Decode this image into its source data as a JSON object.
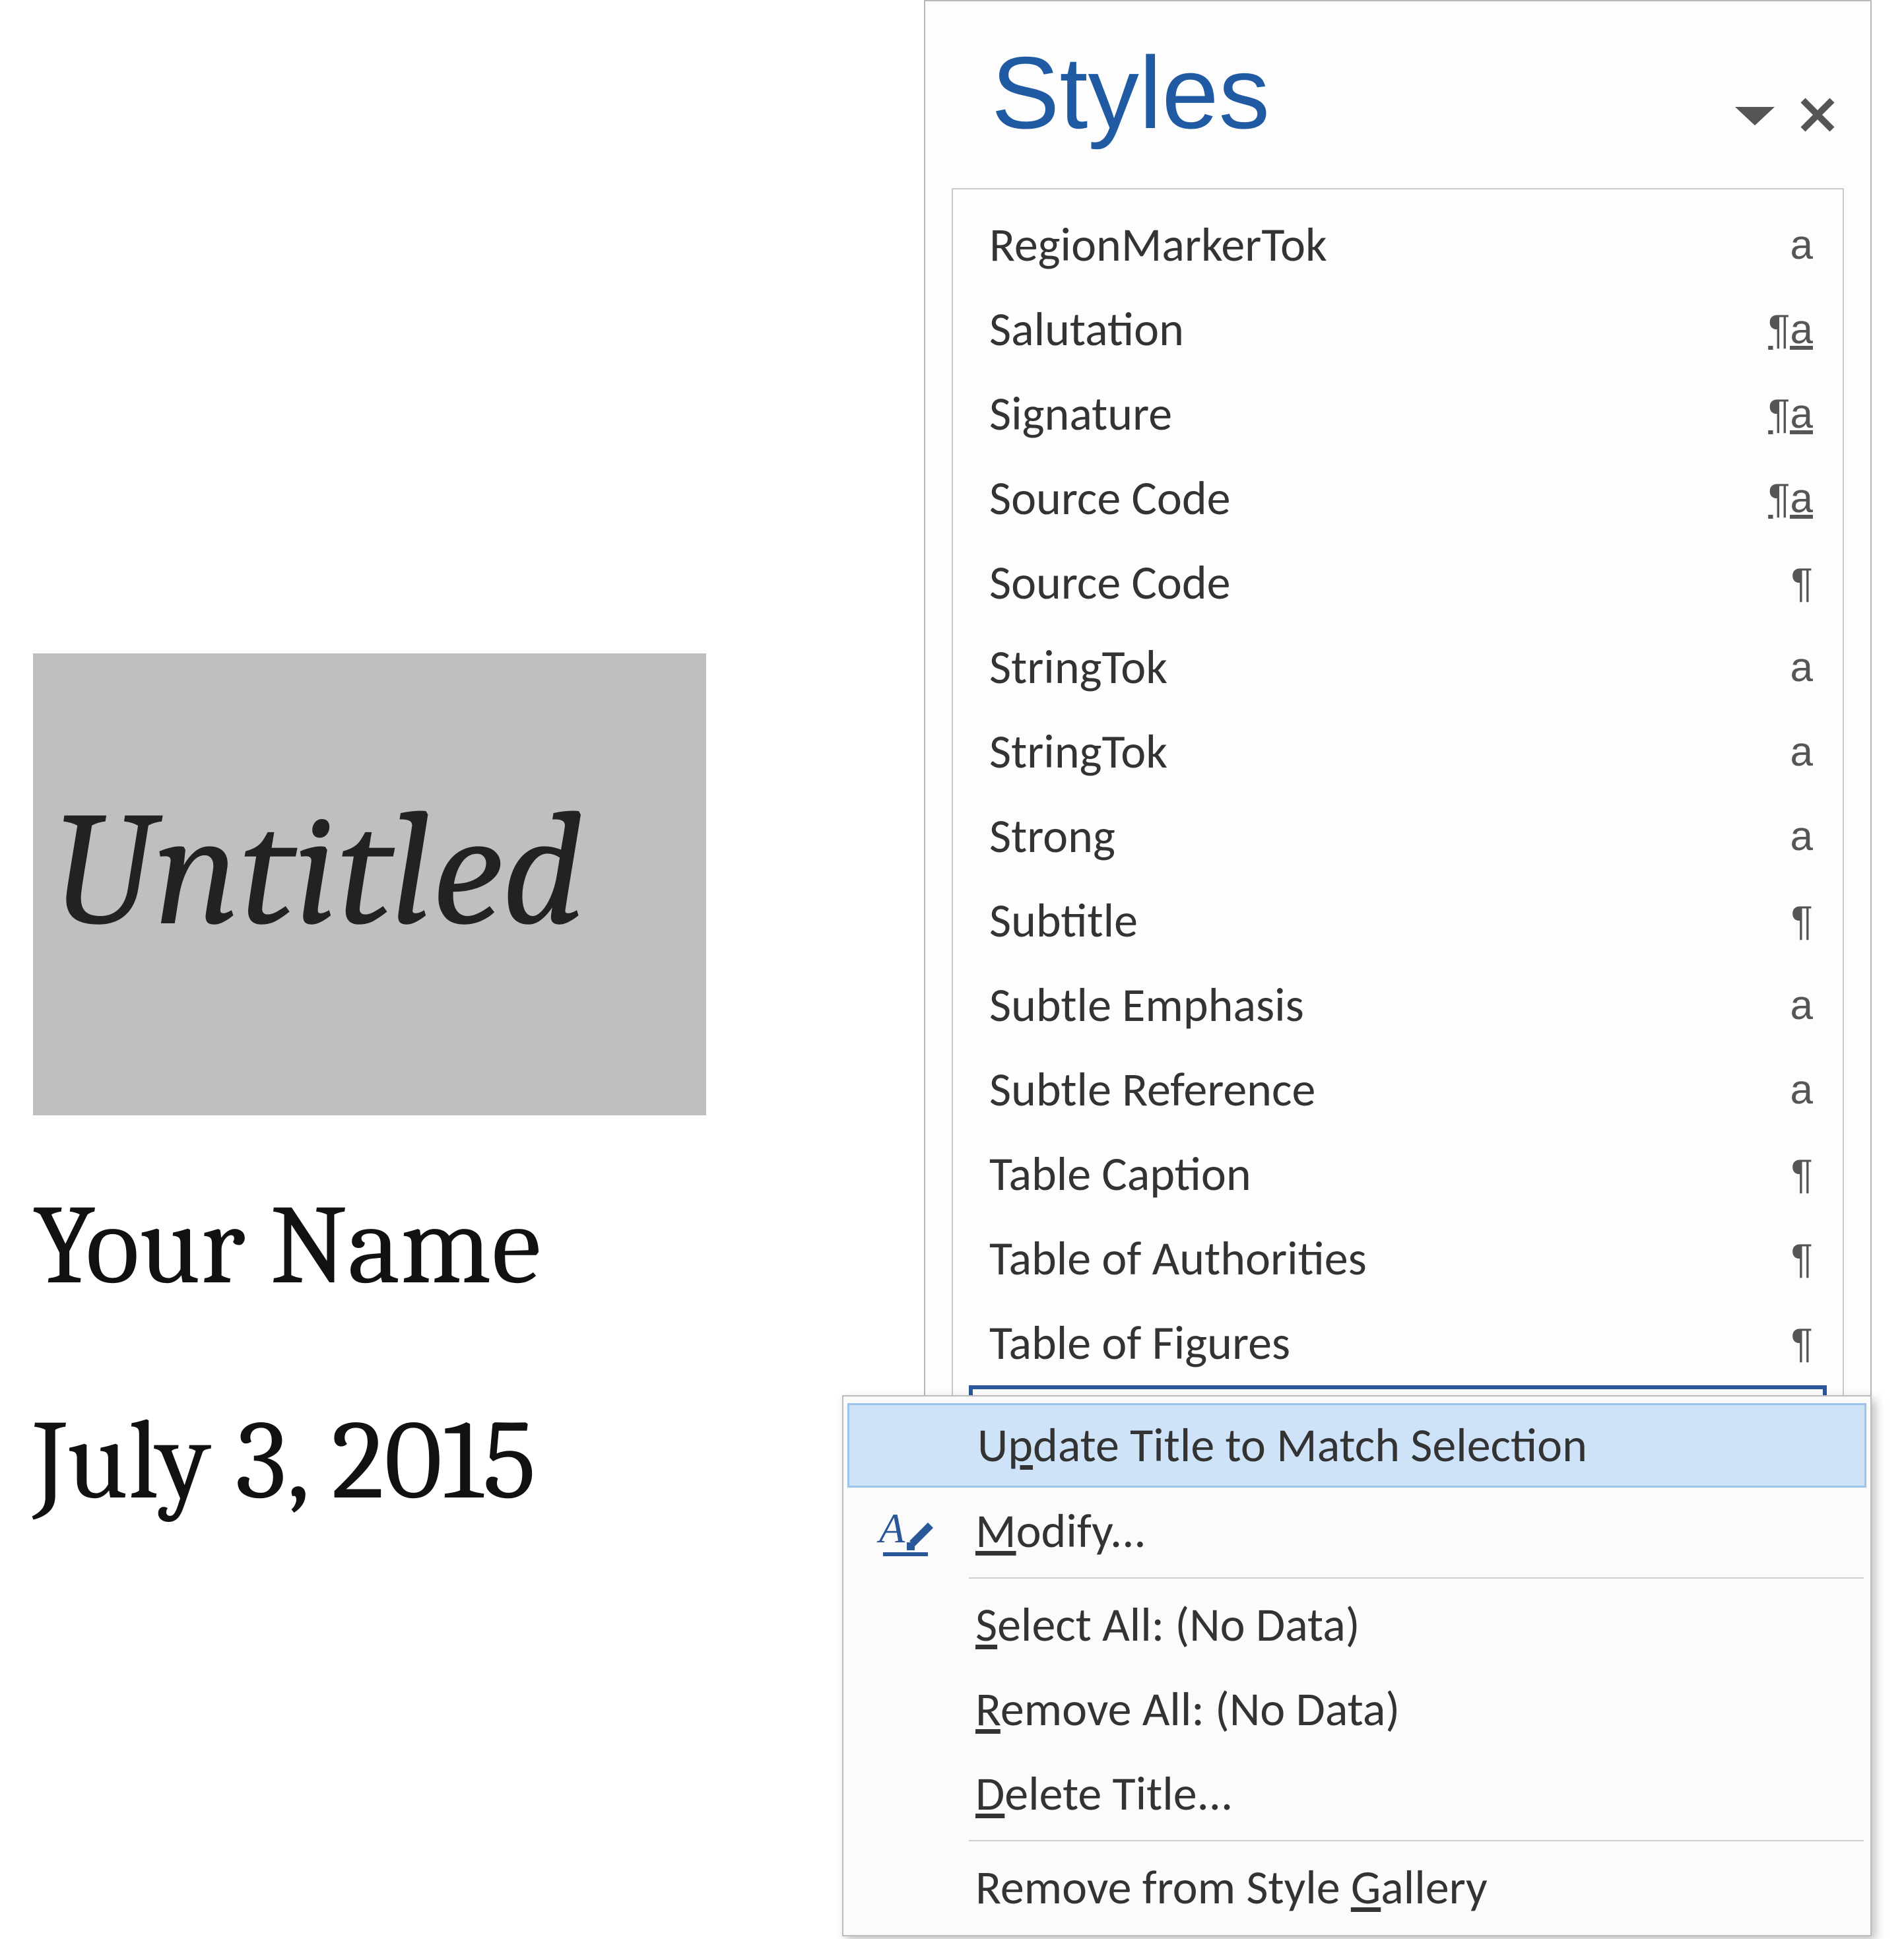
{
  "document": {
    "title_text": "Untitled",
    "author_text": "Your Name",
    "date_text": "July 3, 2015"
  },
  "pane": {
    "title": "Styles"
  },
  "styles": {
    "items": [
      {
        "name": "RegionMarkerTok",
        "type_glyph": "a",
        "type_class": "char"
      },
      {
        "name": "Salutation",
        "type_glyph": "¶a",
        "type_class": "linked"
      },
      {
        "name": "Signature",
        "type_glyph": "¶a",
        "type_class": "linked"
      },
      {
        "name": "Source Code",
        "type_glyph": "¶a",
        "type_class": "linked"
      },
      {
        "name": "Source Code",
        "type_glyph": "¶",
        "type_class": "para"
      },
      {
        "name": "StringTok",
        "type_glyph": "a",
        "type_class": "char"
      },
      {
        "name": "StringTok",
        "type_glyph": "a",
        "type_class": "char"
      },
      {
        "name": "Strong",
        "type_glyph": "a",
        "type_class": "char"
      },
      {
        "name": "Subtitle",
        "type_glyph": "¶",
        "type_class": "para"
      },
      {
        "name": "Subtle Emphasis",
        "type_glyph": "a",
        "type_class": "char"
      },
      {
        "name": "Subtle Reference",
        "type_glyph": "a",
        "type_class": "char"
      },
      {
        "name": "Table Caption",
        "type_glyph": "¶",
        "type_class": "para"
      },
      {
        "name": "Table of Authorities",
        "type_glyph": "¶",
        "type_class": "para"
      },
      {
        "name": "Table of Figures",
        "type_glyph": "¶",
        "type_class": "para"
      }
    ],
    "selected": {
      "name": "Title"
    }
  },
  "context_menu": {
    "update_prefix": "U",
    "update_mn": "p",
    "update_suffix": "date Title to Match Selection",
    "modify_mn": "M",
    "modify_suffix": "odify...",
    "select_mn": "S",
    "select_suffix": "elect All: (No Data)",
    "remove_mn": "R",
    "remove_suffix": "emove All: (No Data)",
    "delete_mn": "D",
    "delete_suffix": "elete Title...",
    "gallery_prefix": "Remove from Style ",
    "gallery_mn": "G",
    "gallery_suffix": "allery"
  }
}
